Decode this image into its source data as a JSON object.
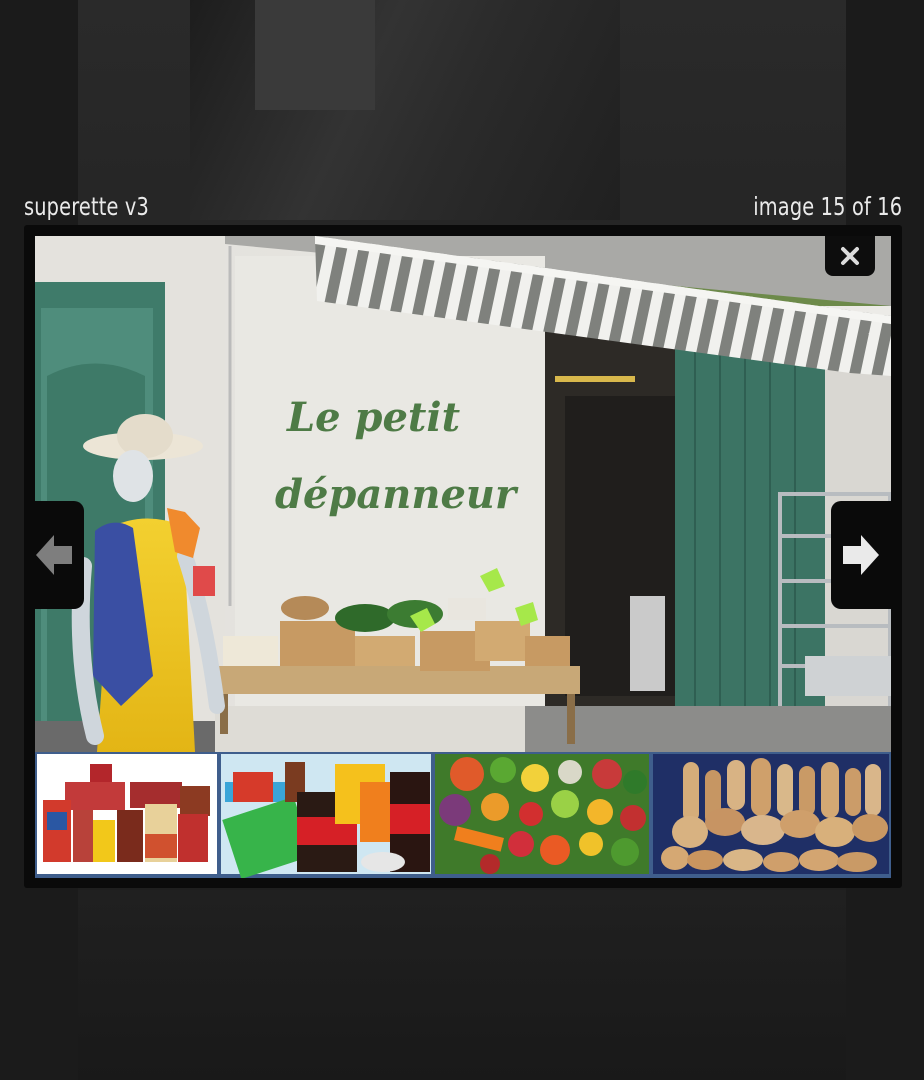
{
  "lightbox": {
    "title": "superette v3",
    "counter": "image 15 of 16"
  },
  "photo": {
    "sign_line1": "Le petit",
    "sign_line2": "dépanneur"
  },
  "icons": {
    "close": "close-icon",
    "previous": "arrow-left-icon",
    "next": "arrow-right-icon"
  },
  "colors": {
    "overlay": "#151515",
    "frame": "#0a0a0a",
    "caption": "#eaeaea",
    "sign_green": "#4e7b46",
    "door_green": "#3f7b68"
  }
}
